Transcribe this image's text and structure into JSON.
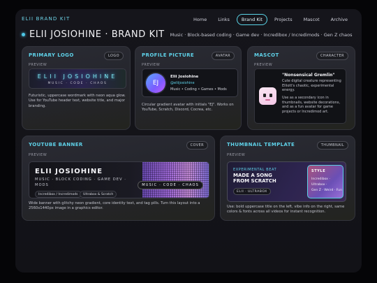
{
  "brand": "ELII BRAND KIT",
  "nav": [
    "Home",
    "Links",
    "Brand Kit",
    "Projects",
    "Mascot",
    "Archive"
  ],
  "nav_active": "Brand Kit",
  "header": {
    "title": "ELII JOSIOHINE · BRAND KIT",
    "subtitle": "Music · Block-based coding · Game dev · Incredibox / Incredimods · Gen Z chaos"
  },
  "cards": {
    "logo": {
      "title": "PRIMARY LOGO",
      "tag": "LOGO",
      "label": "PREVIEW",
      "wordmark": "ELII JOSIOHINE",
      "tagline": "MUSIC · CODE · CHAOS",
      "description": [
        "Futuristic, uppercase wordmark with neon aqua glow.",
        "Use for YouTube header text, website title, and major",
        "branding."
      ]
    },
    "profile": {
      "title": "PROFILE PICTURE",
      "tag": "AVATAR",
      "label": "PREVIEW",
      "initials": "EJ",
      "name": "Elii Josiohine",
      "handle": "@eliijosiohine",
      "tags": "Music • Coding • Games • Mods",
      "description": [
        "Circular gradient avatar with initials \"EJ\". Works on",
        "YouTube, Scratch, Discord, Cocrea, etc."
      ]
    },
    "mascot": {
      "title": "MASCOT",
      "tag": "CHARACTER",
      "label": "PREVIEW",
      "name": "\"Nonsensical Gremlin\"",
      "text1": [
        "Cute digital creature representing",
        "Elliott's chaotic, experimental",
        "energy."
      ],
      "text2": [
        "Use as a secondary icon in",
        "thumbnails, website decorations,",
        "and as a fun avatar for game",
        "projects or Incredimod art."
      ]
    },
    "youtube": {
      "title": "YOUTUBE BANNER",
      "tag": "COVER",
      "label": "PREVIEW",
      "name": "ELII JOSIOHINE",
      "line1": "MUSIC · BLOCK CODING · GAME DEV ·",
      "line2": "MODS",
      "pills": [
        "Incredibox / Incredimods",
        "Ultrabox & Scratch"
      ],
      "strip": "MUSIC · CODE · CHAOS",
      "description": [
        "Wide banner with glitchy neon gradient, core identity text, and tag pills. Turn this layout into a",
        "2560x1440px image in a graphics editor."
      ]
    },
    "thumbnail": {
      "title": "THUMBNAIL TEMPLATE",
      "tag": "THUMBNAIL",
      "label": "PREVIEW",
      "kicker": "EXPERIMENTAL BEAT",
      "headline": [
        "MADE A SONG",
        "FROM SCRATCH"
      ],
      "pill": "ELII · ULTRABOX",
      "style_head": "STYLE",
      "style_lines": [
        "Incredibox ·",
        "Ultrabox ·",
        "Gen Z · Weird · Fun"
      ],
      "description": [
        "Use: bold uppercase title on the left, vibe info on the right, same",
        "colors & fonts across all videos for instant recognition."
      ]
    }
  },
  "colors": {
    "accent": "#5fd3ea",
    "background": "#050507",
    "card": "#2a2b33"
  }
}
